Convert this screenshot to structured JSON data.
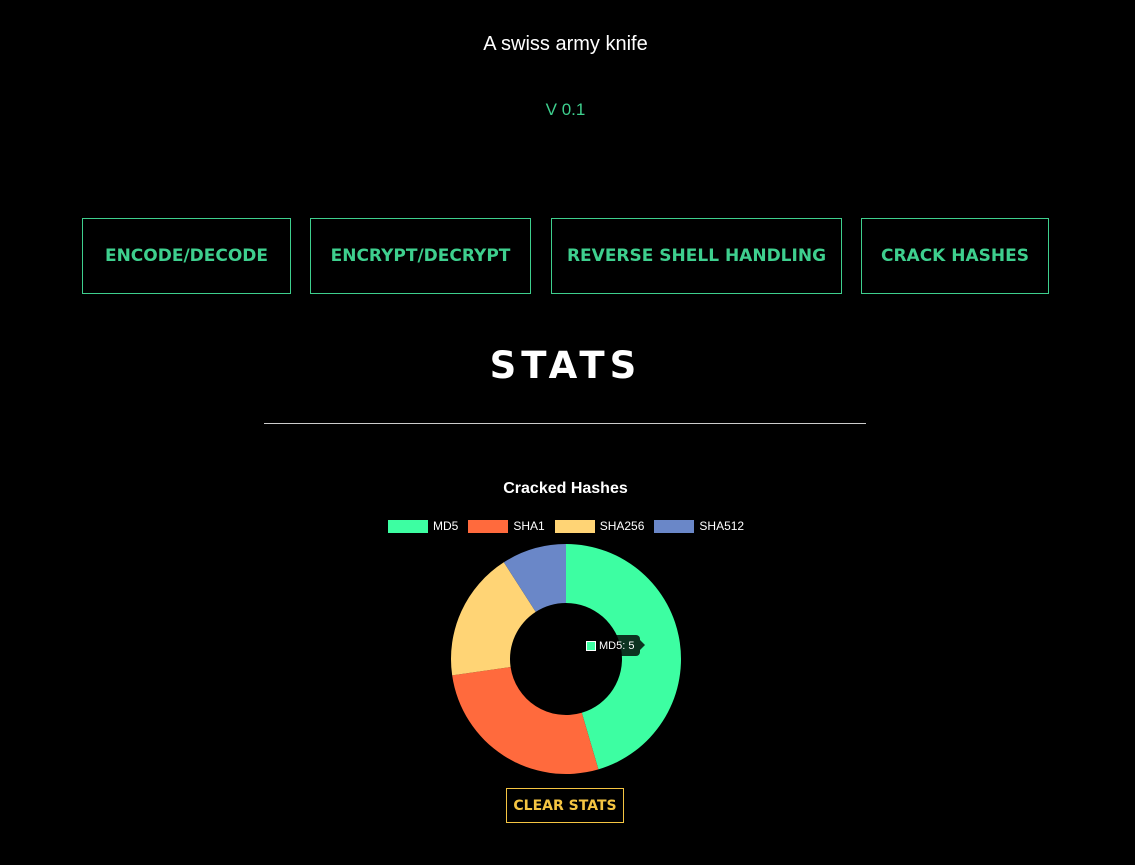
{
  "header": {
    "subtitle": "A swiss army knife",
    "version": "V 0.1"
  },
  "nav": {
    "items": [
      {
        "label": "ENCODE/DECODE"
      },
      {
        "label": "ENCRYPT/DECRYPT"
      },
      {
        "label": "REVERSE SHELL HANDLING"
      },
      {
        "label": "CRACK HASHES"
      }
    ]
  },
  "stats": {
    "title": "STATS",
    "clear_label": "CLEAR STATS"
  },
  "colors": {
    "accent": "#3ecf8e",
    "clear_button": "#f5c542"
  },
  "chart_data": {
    "type": "pie",
    "title": "Cracked Hashes",
    "categories": [
      "MD5",
      "SHA1",
      "SHA256",
      "SHA512"
    ],
    "values": [
      5,
      3,
      2,
      1
    ],
    "colors": [
      "#3dfea2",
      "#ff6a3d",
      "#ffd475",
      "#6a87c8"
    ],
    "legend": "top",
    "tooltip": {
      "label": "MD5: 5",
      "category": "MD5"
    }
  }
}
